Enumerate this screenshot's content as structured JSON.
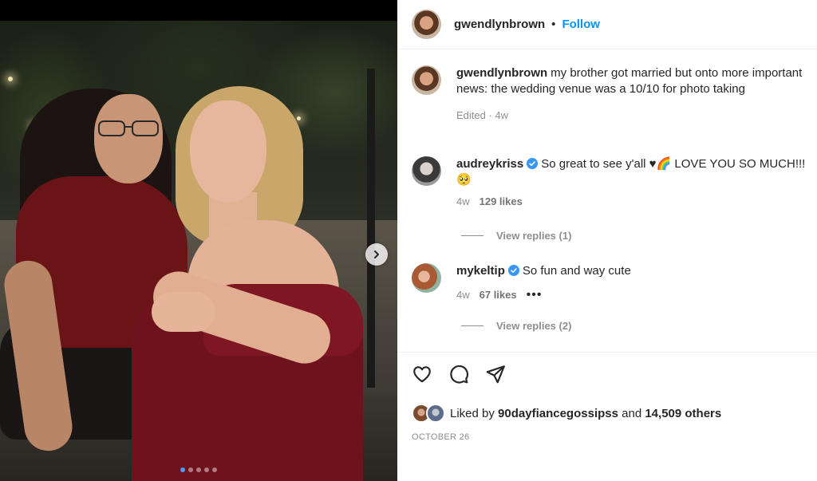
{
  "header": {
    "username": "gwendlynbrown",
    "separator": "•",
    "follow_label": "Follow"
  },
  "caption": {
    "username": "gwendlynbrown",
    "text": "my brother got married but onto more important news: the wedding venue was a 10/10 for photo taking",
    "meta": "Edited · 4w"
  },
  "comments": [
    {
      "username": "audreykriss",
      "verified": true,
      "text": "So great to see y'all ♥🌈 LOVE YOU SO MUCH!!! 🥺",
      "time": "4w",
      "likes": "129 likes",
      "view_replies": "View replies (1)"
    },
    {
      "username": "mykeltip",
      "verified": true,
      "text": "So fun and way cute",
      "time": "4w",
      "likes": "67 likes",
      "more": "•••",
      "view_replies": "View replies (2)"
    }
  ],
  "liked_by": {
    "prefix": "Liked by",
    "user": "90dayfiancegossipss",
    "and": "and",
    "others": "14,509 others"
  },
  "date": "OCTOBER 26",
  "carousel": {
    "total": 5,
    "active": 1
  },
  "icons": {
    "like": "heart-icon",
    "comment": "comment-icon",
    "share": "share-icon",
    "next": "chevron-right-icon",
    "verified": "verified-badge-icon"
  },
  "colors": {
    "follow": "#0095f6",
    "verified": "#3897f0",
    "active_dot": "#4c9bf5"
  }
}
